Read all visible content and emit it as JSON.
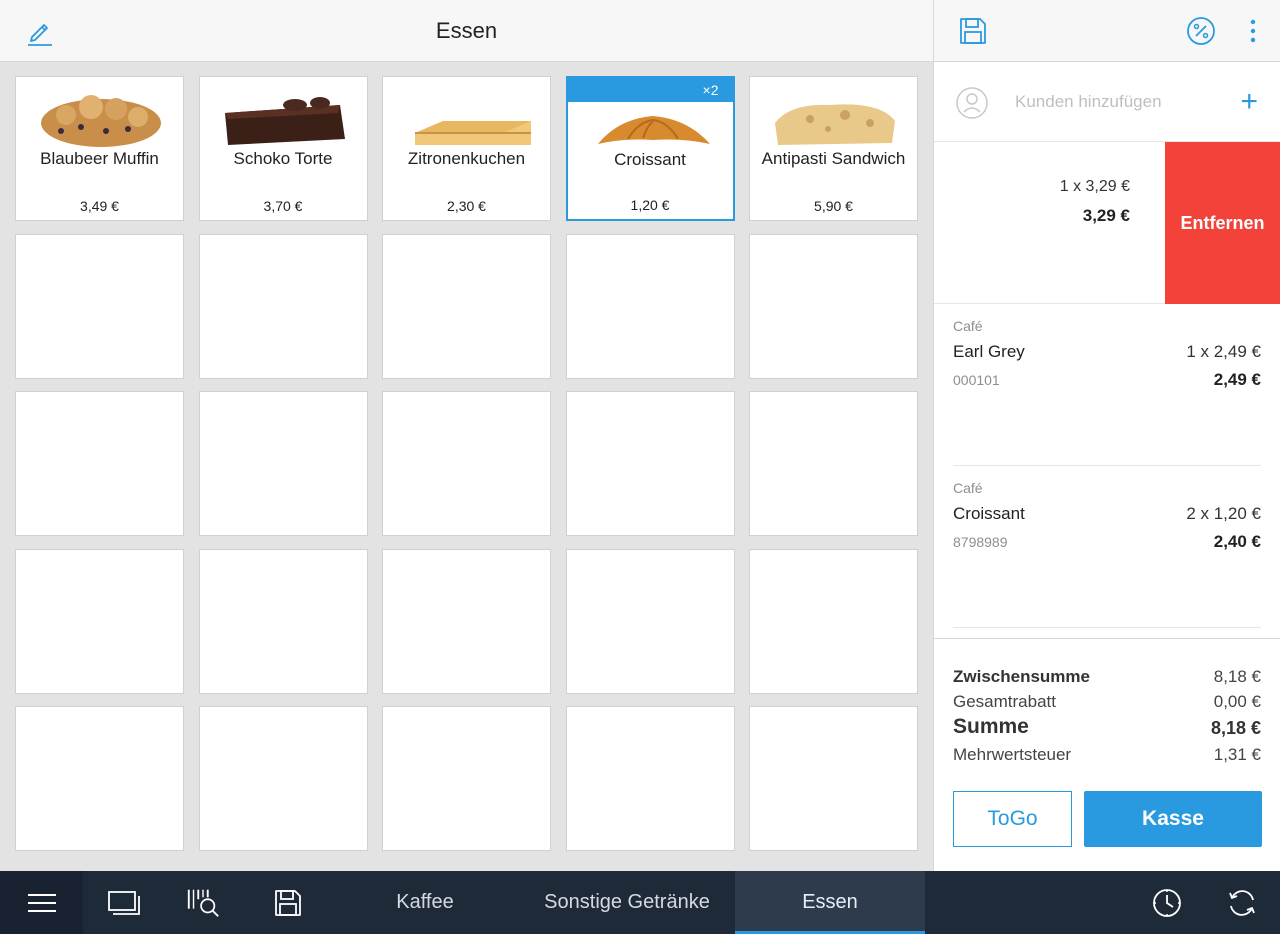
{
  "header": {
    "title": "Essen"
  },
  "products": [
    {
      "name": "Blaubeer Muffin",
      "price": "3,49 €"
    },
    {
      "name": "Schoko Torte",
      "price": "3,70 €"
    },
    {
      "name": "Zitronenkuchen",
      "price": "2,30 €"
    },
    {
      "name": "Croissant",
      "price": "1,20 €",
      "selected": true,
      "badge": "×2"
    },
    {
      "name": "Antipasti Sandwich",
      "price": "5,90 €"
    }
  ],
  "cart": {
    "customer_placeholder": "Kunden hinzufügen",
    "swiped_item": {
      "qty_price": "1 x 3,29 €",
      "total": "3,29 €",
      "remove_label": "Entfernen"
    },
    "items": [
      {
        "category": "Café",
        "name": "Earl Grey",
        "sku": "000101",
        "qty_price": "1 x 2,49 €",
        "total": "2,49 €"
      },
      {
        "category": "Café",
        "name": "Croissant",
        "sku": "8798989",
        "qty_price": "2 x 1,20 €",
        "total": "2,40 €"
      }
    ],
    "totals": {
      "subtotal_label": "Zwischensumme",
      "subtotal": "8,18 €",
      "discount_label": "Gesamtrabatt",
      "discount": "0,00 €",
      "sum_label": "Summe",
      "sum": "8,18 €",
      "vat_label": "Mehrwertsteuer",
      "vat": "1,31 €"
    },
    "togo_label": "ToGo",
    "checkout_label": "Kasse"
  },
  "bottom_tabs": [
    {
      "label": "Kaffee"
    },
    {
      "label": "Sonstige Getränke"
    },
    {
      "label": "Essen",
      "active": true
    }
  ],
  "colors": {
    "accent": "#2a9ae0",
    "danger": "#f2423a",
    "bottom_bar": "#1f2a38"
  }
}
